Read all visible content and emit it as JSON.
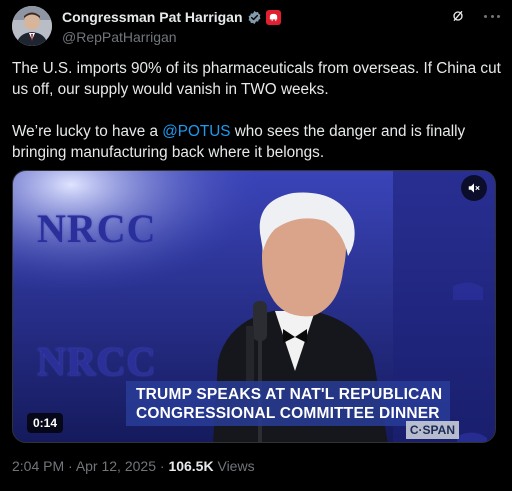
{
  "author": {
    "display_name": "Congressman Pat Harrigan",
    "handle": "@RepPatHarrigan"
  },
  "icons": {
    "verified": "verified-badge-icon",
    "affiliation": "gop-elephant-icon",
    "grok": "grok-icon",
    "more": "more-dots-icon",
    "mute": "mute-speaker-icon"
  },
  "tweet": {
    "paragraph_1": "The U.S. imports 90% of its pharmaceuticals from overseas. If China cut us off, our supply would vanish in TWO weeks.",
    "paragraph_2_prefix": "We’re lucky to have a ",
    "mention": "@POTUS",
    "paragraph_2_suffix": " who sees the danger and is finally bringing manufacturing back where it belongs."
  },
  "media": {
    "backdrop_text_1": "NRCC",
    "backdrop_text_2": "NRCC",
    "caption_line_1": "TRUMP SPEAKS AT NAT'L REPUBLICAN",
    "caption_line_2": "CONGRESSIONAL COMMITTEE DINNER",
    "duration": "0:14",
    "network_bug": "C·SPAN"
  },
  "meta": {
    "time": "2:04 PM",
    "separator": " · ",
    "date": "Apr 12, 2025",
    "views_count": "106.5K",
    "views_label": " Views"
  },
  "colors": {
    "background": "#000000",
    "text": "#e7e9ea",
    "muted": "#71767b",
    "link": "#1d9bf0",
    "verified": "#829aab",
    "affiliation": "#e0202e"
  }
}
